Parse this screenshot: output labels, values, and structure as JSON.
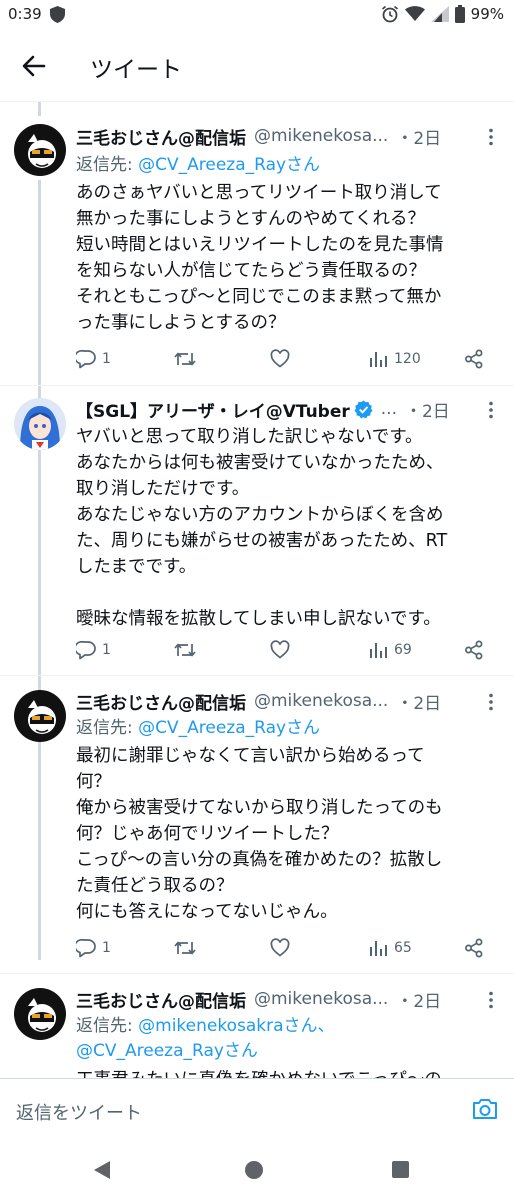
{
  "status": {
    "time": "0:39",
    "battery": "99%"
  },
  "header": {
    "title": "ツイート"
  },
  "tweets": [
    {
      "name": "三毛おじさん@配信垢",
      "handle": "@mikenekosa...",
      "time": "・2日",
      "reply_prefix": "返信先: ",
      "reply_link": "@CV_Areeza_Rayさん",
      "reply_link2": "",
      "body": "あのさぁヤバいと思ってリツイート取り消して\n無かった事にしようとすんのやめてくれる？\n短い時間とはいえリツイートしたのを見た事情\nを知らない人が信じてたらどう責任取るの？\nそれともこっぴ〜と同じでこのまま黙って無か\nった事にしようとするの？",
      "replies": "1",
      "views": "120"
    },
    {
      "name": "【SGL】アリーザ・レイ@VTuber",
      "handle": "...",
      "time": "・2日",
      "body": "ヤバいと思って取り消した訳じゃないです。\nあなたからは何も被害受けていなかったため、\n取り消しただけです。\nあなたじゃない方のアカウントからぼくを含め\nた、周りにも嫌がらせの被害があったため、RT\nしたまでです。\n\n曖昧な情報を拡散してしまい申し訳ないです。",
      "replies": "1",
      "views": "69"
    },
    {
      "name": "三毛おじさん@配信垢",
      "handle": "@mikenekosa...",
      "time": "・2日",
      "reply_prefix": "返信先: ",
      "reply_link": "@CV_Areeza_Rayさん",
      "body": "最初に謝罪じゃなくて言い訳から始めるって\n何？\n俺から被害受けてないから取り消したってのも\n何？じゃあ何でリツイートした？\nこっぴ〜の言い分の真偽を確かめたの？拡散し\nた責任どう取るの？\n何にも答えになってないじゃん。",
      "replies": "1",
      "views": "65"
    },
    {
      "name": "三毛おじさん@配信垢",
      "handle": "@mikenekosa...",
      "time": "・2日",
      "reply_prefix": "返信先: ",
      "reply_link": "@mikenekosakraさん、",
      "reply_link2": "@CV_Areeza_Rayさん",
      "body": "工事君みたいに真偽を確かめないでこっぴ〜の"
    }
  ],
  "composer": {
    "placeholder": "返信をツイート"
  },
  "colors": {
    "accent": "#1d9bf0",
    "muted": "#536471",
    "verified": "#1d9bf0"
  }
}
